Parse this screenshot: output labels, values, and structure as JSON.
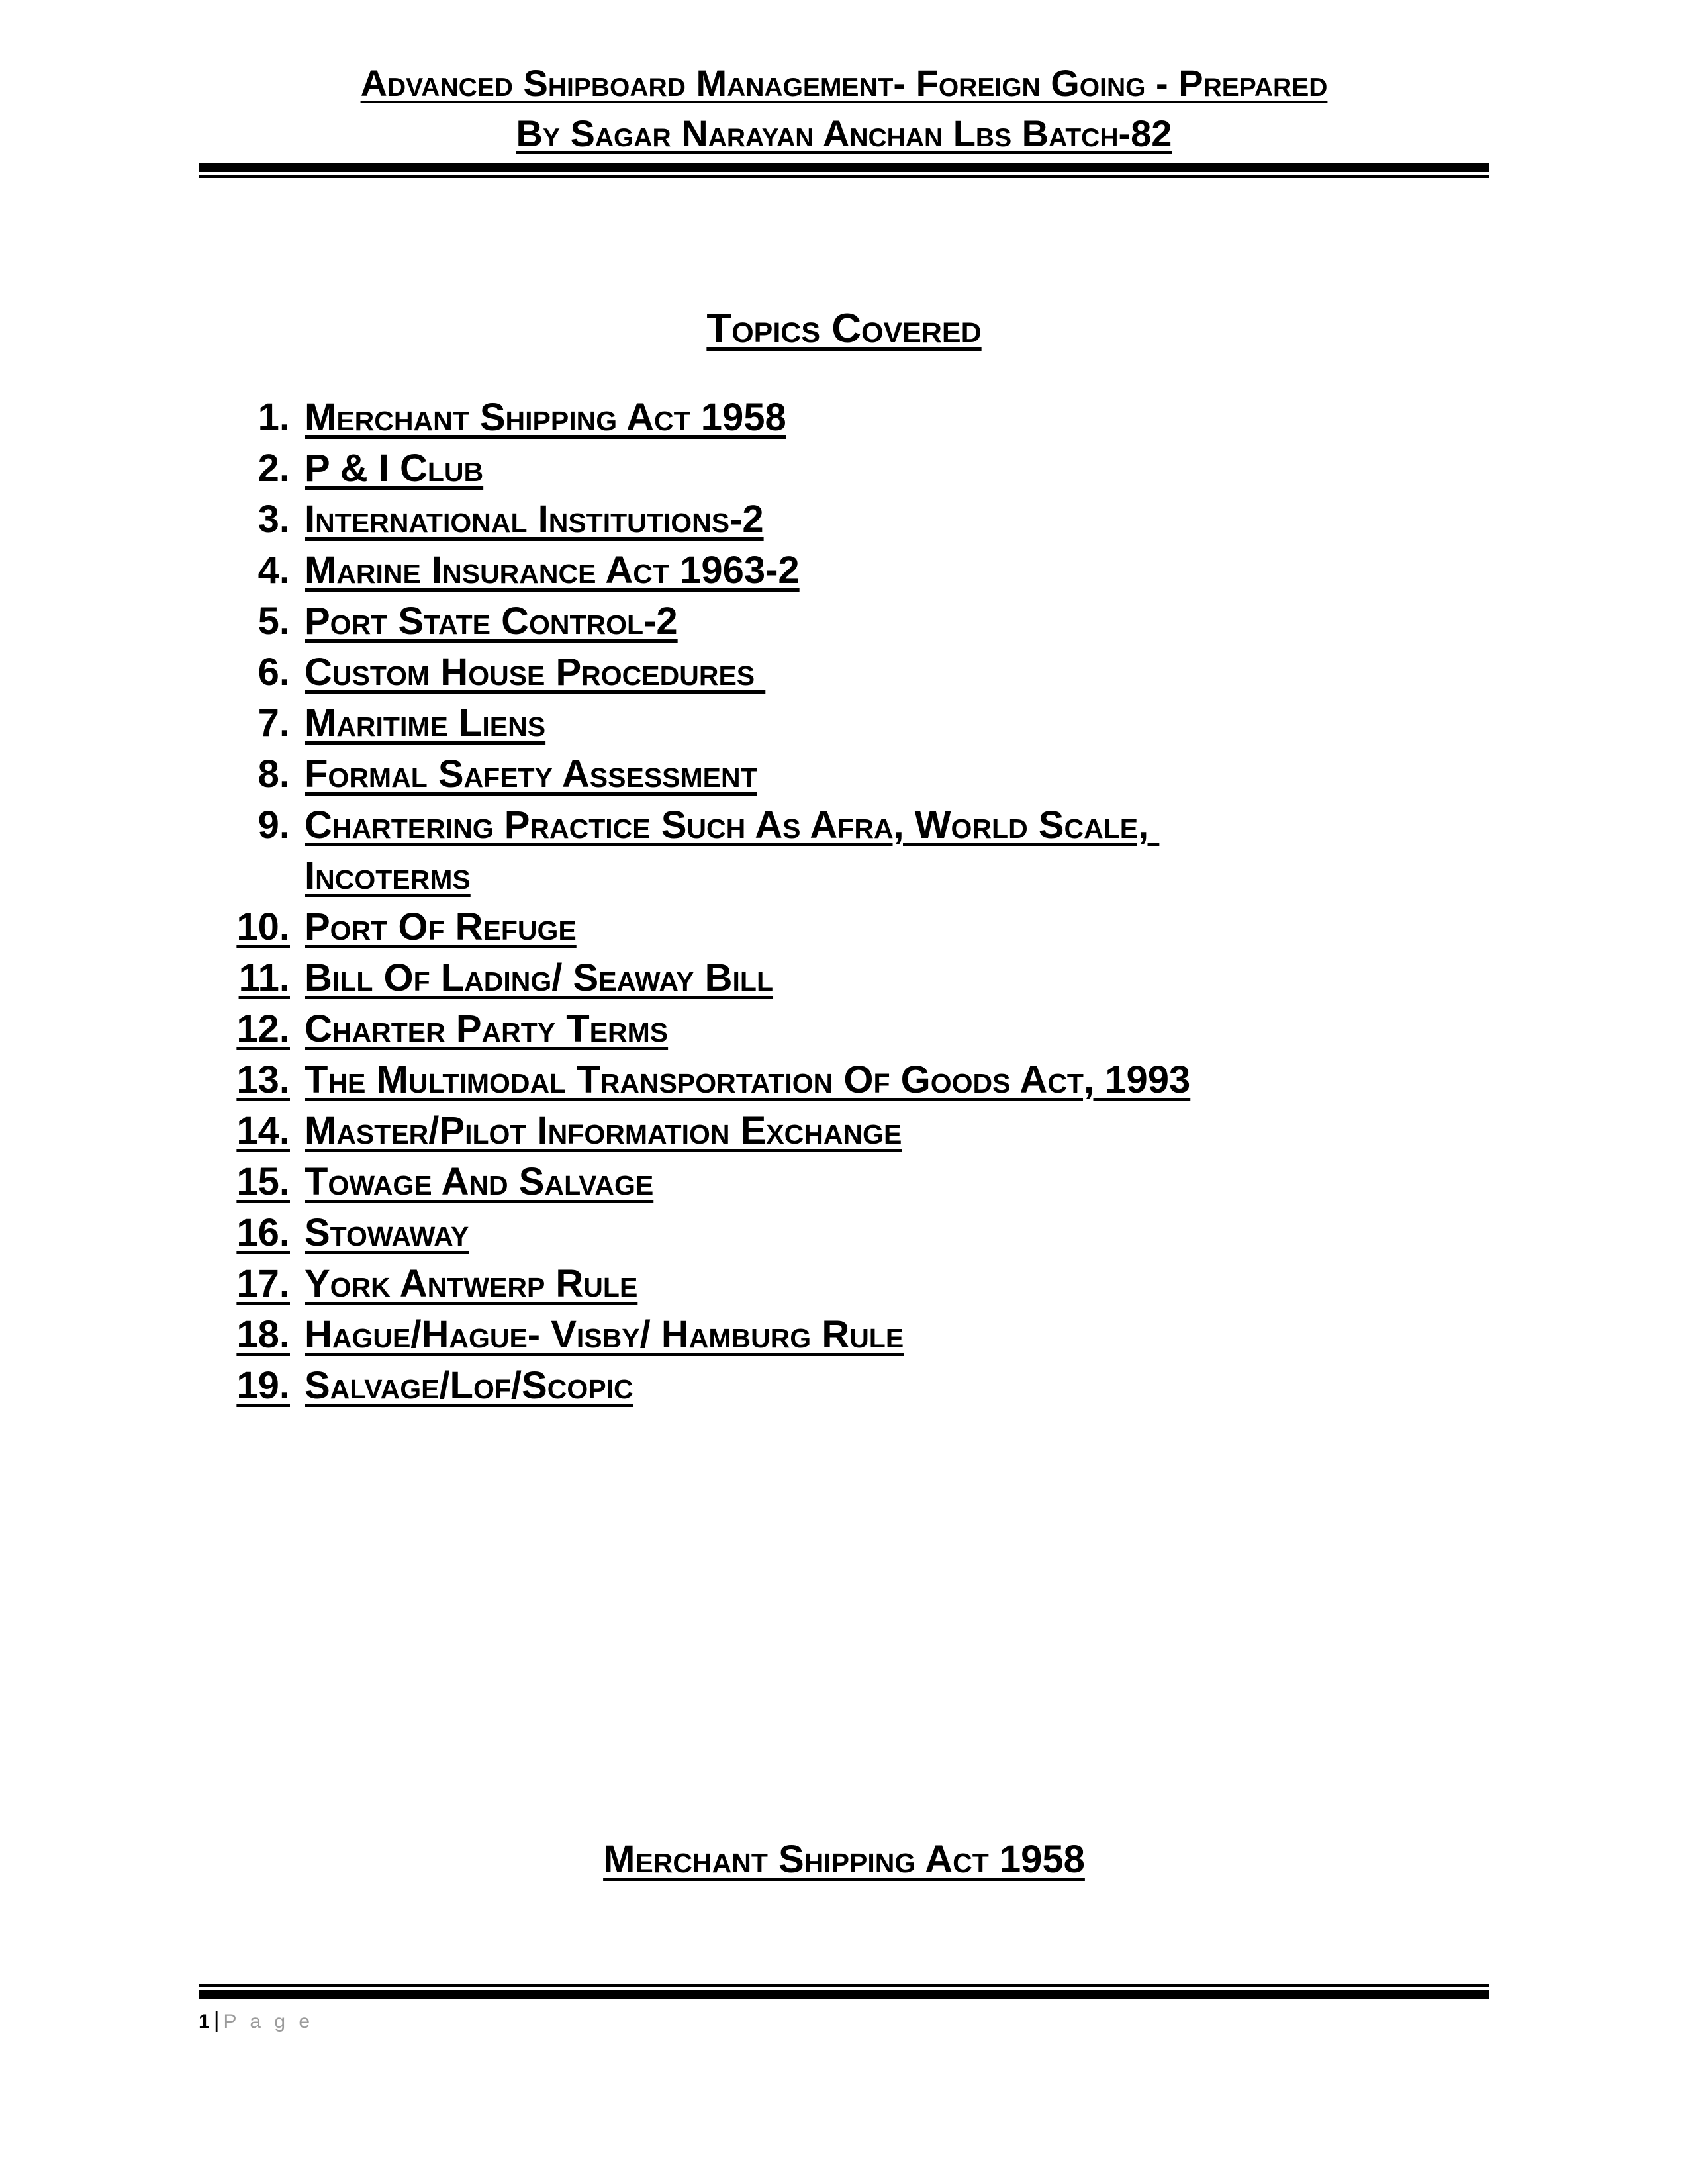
{
  "document": {
    "header": {
      "line1": "Advanced Shipboard Management- Foreign Going - Prepared",
      "line2": "By Sagar Narayan Anchan Lbs Batch-82"
    },
    "title": "Topics Covered",
    "topics": [
      {
        "num": "1.",
        "text": "Merchant Shipping Act 1958"
      },
      {
        "num": "2.",
        "text": "P & I Club"
      },
      {
        "num": "3.",
        "text": "International Institutions-2"
      },
      {
        "num": "4.",
        "text": "Marine Insurance Act 1963-2"
      },
      {
        "num": "5.",
        "text": "Port State Control-2"
      },
      {
        "num": "6.",
        "text": "Custom House Procedures "
      },
      {
        "num": "7.",
        "text": "Maritime Liens"
      },
      {
        "num": "8.",
        "text": "Formal Safety Assessment"
      },
      {
        "num": "9.",
        "text": "Chartering Practice Such As Afra, World Scale, "
      },
      {
        "num": "",
        "text": "Incoterms",
        "continuation": true
      },
      {
        "num": "10.",
        "text": "Port Of Refuge"
      },
      {
        "num": "11.",
        "text": "Bill Of Lading/ Seaway Bill"
      },
      {
        "num": "12.",
        "text": "Charter Party Terms"
      },
      {
        "num": "13.",
        "text": "The Multimodal Transportation Of Goods Act, 1993"
      },
      {
        "num": "14.",
        "text": "Master/Pilot Information Exchange"
      },
      {
        "num": "15.",
        "text": "Towage And Salvage"
      },
      {
        "num": "16.",
        "text": "Stowaway"
      },
      {
        "num": "17.",
        "text": "York Antwerp Rule"
      },
      {
        "num": "18.",
        "text": "Hague/Hague- Visby/ Hamburg Rule"
      },
      {
        "num": "19.",
        "text": "Salvage/Lof/Scopic"
      }
    ],
    "section_heading": "Merchant Shipping Act 1958",
    "footer": {
      "page_number": "1",
      "separator": "|",
      "page_word": "P a g e"
    }
  },
  "colors": {
    "text": "#000000",
    "page_background": "#ffffff",
    "footer_word": "#9b9b9b",
    "rule": "#000000"
  }
}
